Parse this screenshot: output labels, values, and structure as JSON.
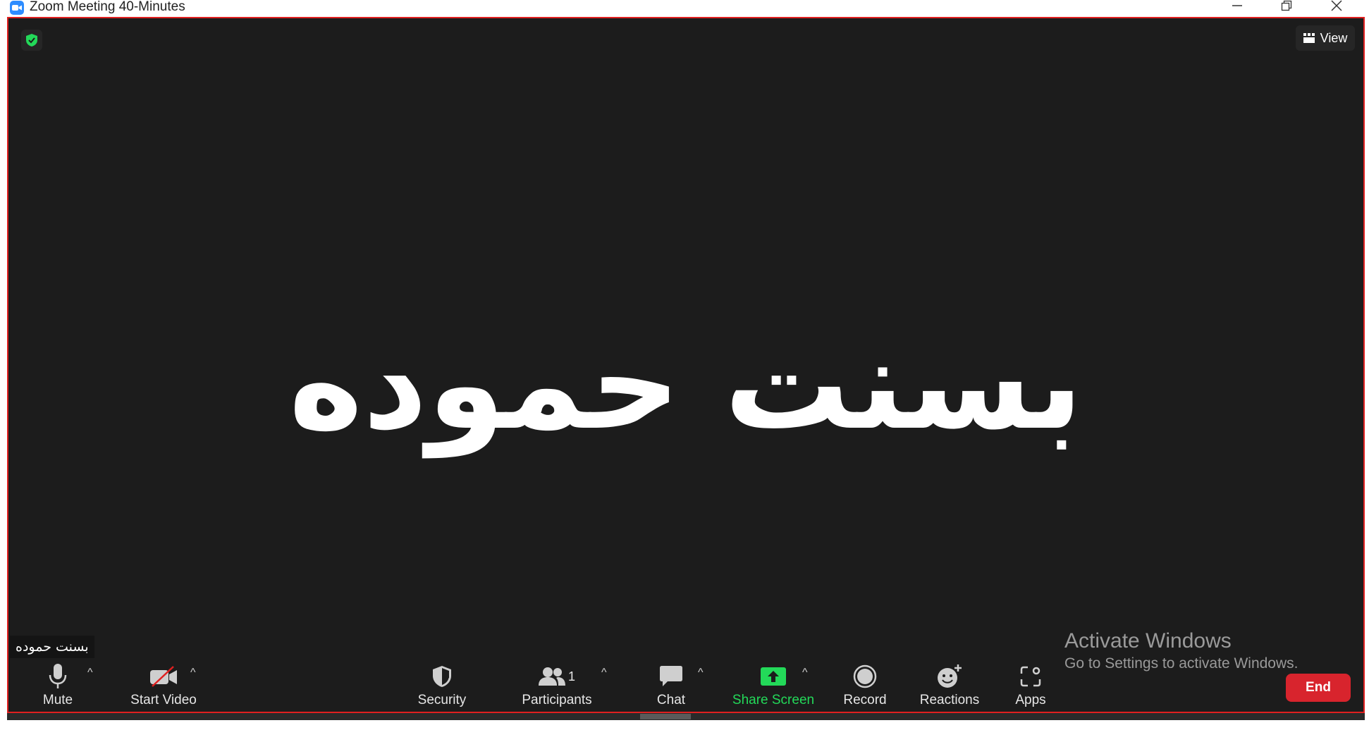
{
  "window": {
    "title": "Zoom Meeting 40-Minutes",
    "controls": [
      "minimize",
      "maximize",
      "close"
    ]
  },
  "meeting": {
    "view_label": "View",
    "participant_display_name": "بسنت حموده",
    "name_tag": "بسنت حموده",
    "encryption_icon": "shield-check-icon",
    "accent_border_color": "#e02020"
  },
  "toolbar": {
    "mute_label": "Mute",
    "video_label": "Start Video",
    "security_label": "Security",
    "participants_label": "Participants",
    "participants_count": "1",
    "chat_label": "Chat",
    "share_label": "Share Screen",
    "record_label": "Record",
    "reactions_label": "Reactions",
    "apps_label": "Apps",
    "end_label": "End",
    "share_color": "#23d959",
    "end_color": "#d8242d"
  },
  "watermark": {
    "line1": "Activate Windows",
    "line2": "Go to Settings to activate Windows."
  }
}
